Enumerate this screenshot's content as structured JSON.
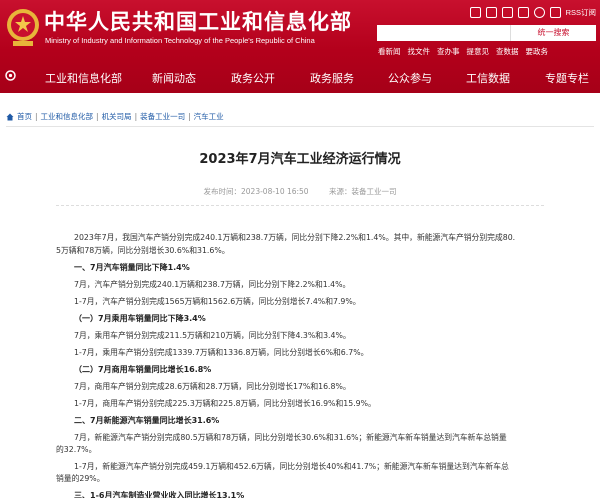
{
  "header": {
    "title_cn": "中华人民共和国工业和信息化部",
    "title_en": "Ministry of Industry and Information Technology of the People's Republic of China",
    "rss": "RSS订阅",
    "search_button": "统一搜索",
    "quick_links": [
      "看新闻",
      "找文件",
      "查办事",
      "提意见",
      "查数据",
      "要政务"
    ]
  },
  "nav": [
    "工业和信息化部",
    "新闻动态",
    "政务公开",
    "政务服务",
    "公众参与",
    "工信数据",
    "专题专栏"
  ],
  "breadcrumb": [
    "首页",
    "工业和信息化部",
    "机关司局",
    "装备工业一司",
    "汽车工业"
  ],
  "article": {
    "title": "2023年7月汽车工业经济运行情况",
    "publish_time": "发布时间：2023-08-10 16:50",
    "source": "来源：装备工业一司",
    "paragraphs": [
      "2023年7月，我国汽车产销分别完成240.1万辆和238.7万辆，同比分别下降2.2%和1.4%。其中，新能源汽车产销分别完成80.",
      "5万辆和78万辆，同比分别增长30.6%和31.6%。",
      "一、7月汽车销量同比下降1.4%",
      "7月，汽车产销分别完成240.1万辆和238.7万辆，同比分别下降2.2%和1.4%。",
      "1-7月，汽车产销分别完成1565万辆和1562.6万辆，同比分别增长7.4%和7.9%。",
      "（一）7月乘用车销量同比下降3.4%",
      "7月，乘用车产销分别完成211.5万辆和210万辆，同比分别下降4.3%和3.4%。",
      "1-7月，乘用车产销分别完成1339.7万辆和1336.8万辆，同比分别增长6%和6.7%。",
      "（二）7月商用车销量同比增长16.8%",
      "7月，商用车产销分别完成28.6万辆和28.7万辆，同比分别增长17%和16.8%。",
      "1-7月，商用车产销分别完成225.3万辆和225.8万辆，同比分别增长16.9%和15.9%。",
      "二、7月新能源汽车销量同比增长31.6%",
      "7月，新能源汽车产销分别完成80.5万辆和78万辆，同比分别增长30.6%和31.6%；新能源汽车新车销量达到汽车新车总销量",
      "的32.7%。",
      "1-7月，新能源汽车产销分别完成459.1万辆和452.6万辆，同比分别增长40%和41.7%；新能源汽车新车销量达到汽车新车总",
      "销量的29%。",
      "三、1-6月汽车制造业营业收入同比增长13.1%"
    ]
  }
}
